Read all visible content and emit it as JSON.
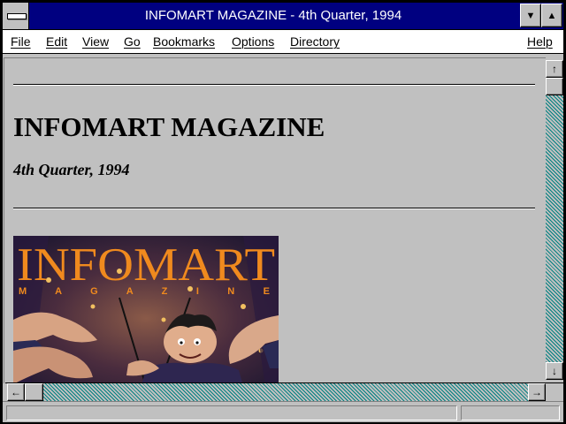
{
  "window": {
    "title": "INFOMART MAGAZINE - 4th Quarter, 1994"
  },
  "titlebar": {
    "minimize_glyph": "▼",
    "maximize_glyph": "▲"
  },
  "menu": [
    {
      "label": "File"
    },
    {
      "label": "Edit"
    },
    {
      "label": "View"
    },
    {
      "label": "Go"
    },
    {
      "label": "Bookmarks"
    },
    {
      "label": "Options"
    },
    {
      "label": "Directory"
    },
    {
      "label": "Help"
    }
  ],
  "document": {
    "heading": "INFOMART MAGAZINE",
    "subheading": "4th Quarter, 1994",
    "cover": {
      "masthead": "INFOMART",
      "tagline": "M A G A Z I N E"
    }
  },
  "scroll": {
    "up_glyph": "↑",
    "down_glyph": "↓",
    "left_glyph": "←",
    "right_glyph": "→"
  },
  "status": {
    "text": "",
    "progress": 0
  },
  "colors": {
    "title_bg": "#000080",
    "chrome": "#c0c0c0",
    "track": "#008080",
    "masthead": "#f08a1e"
  }
}
